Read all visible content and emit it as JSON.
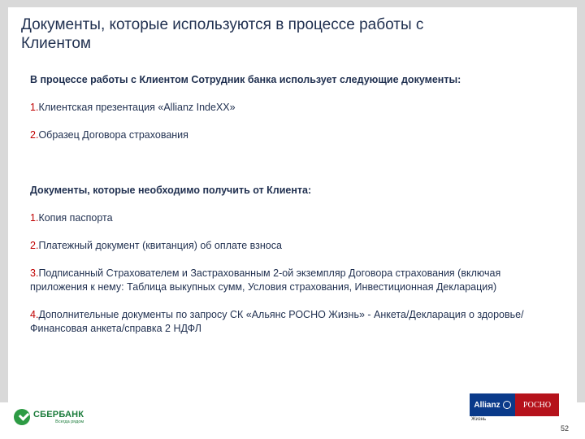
{
  "title": "Документы, которые используются в процессе работы с Клиентом",
  "section1": {
    "heading": "В процессе работы с Клиентом Сотрудник банка использует следующие документы:",
    "items": [
      {
        "num": "1.",
        "text": "Клиентская презентация «Allianz IndeXX»"
      },
      {
        "num": "2.",
        "text": "Образец  Договора страхования"
      }
    ]
  },
  "section2": {
    "heading": "Документы, которые необходимо получить от Клиента:",
    "items": [
      {
        "num": "1.",
        "text": "Копия паспорта"
      },
      {
        "num": "2.",
        "text": "Платежный документ  (квитанция) об оплате взноса"
      },
      {
        "num": "3.",
        "text": "Подписанный Страхователем и Застрахованным 2-ой экземпляр Договора страхования (включая приложения к нему: Таблица выкупных сумм, Условия страхования, Инвестиционная Декларация)"
      },
      {
        "num": "4.",
        "text": "Дополнительные документы по запросу СК «Альянс РОСНО Жизнь»  - Анкета/Декларация о здоровье/Финансовая анкета/справка  2 НДФЛ"
      }
    ]
  },
  "footer": {
    "sber_name": "СБЕРБАНК",
    "sber_tagline": "Всегда рядом",
    "allianz": "Allianz",
    "rosno": "РОСНО",
    "partner_sub": "Жизнь",
    "page_number": "52"
  },
  "colors": {
    "title": "#1f2f4f",
    "number": "#c00000",
    "background": "#d9d9d9"
  }
}
